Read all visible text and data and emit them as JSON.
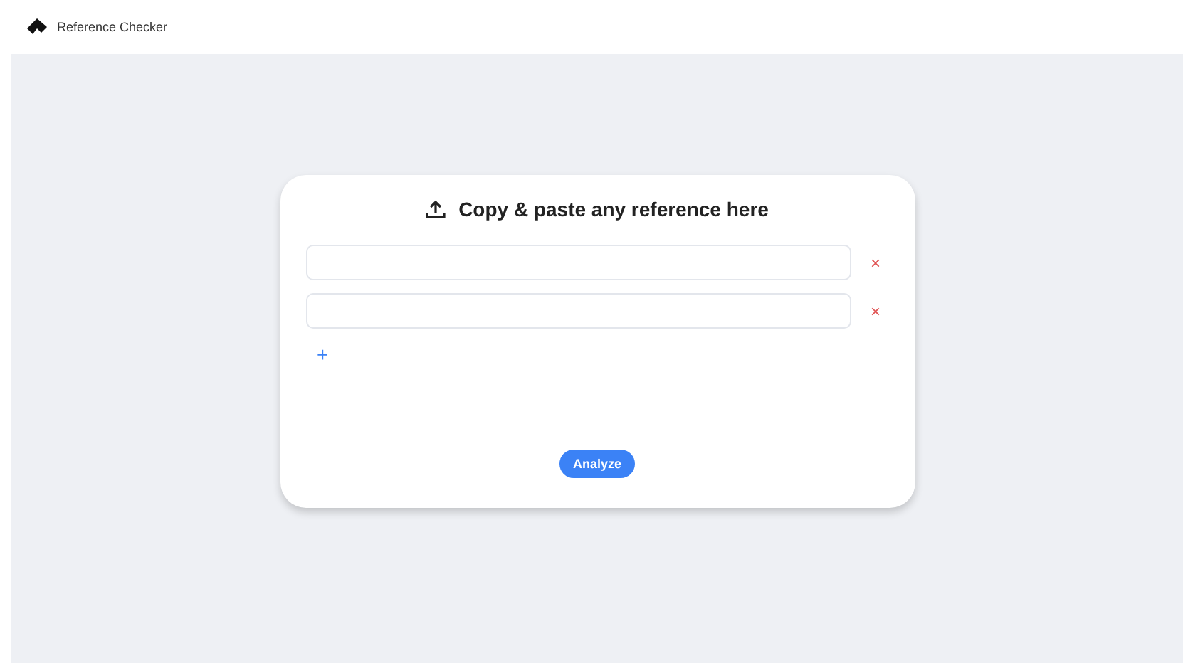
{
  "app": {
    "title": "Reference Checker"
  },
  "card": {
    "heading": "Copy & paste any reference here",
    "references": [
      {
        "remove": "×"
      },
      {
        "remove": "×"
      }
    ],
    "add": "+",
    "button": "Analyze"
  }
}
